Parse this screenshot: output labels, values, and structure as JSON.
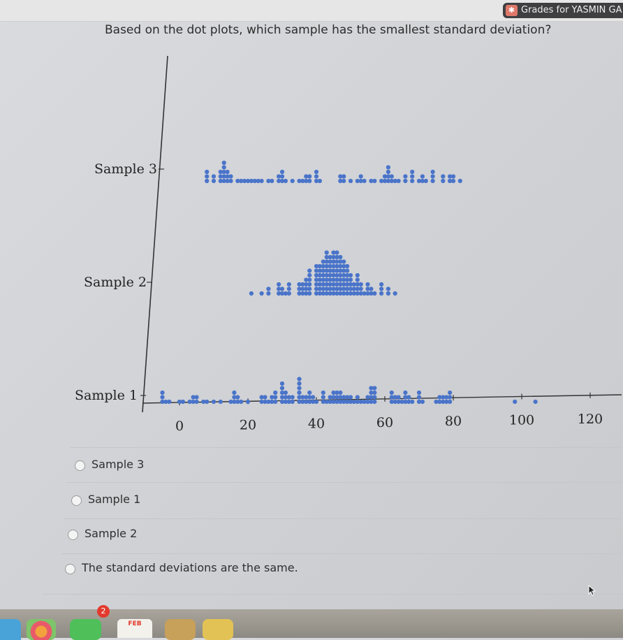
{
  "browser": {
    "tab_title": "Grades for YASMIN GA",
    "tab_icon": "grades-icon"
  },
  "question": {
    "text": "Based on the dot plots, which sample has the smallest standard deviation?"
  },
  "chart_data": {
    "type": "scatter",
    "subtype": "dot plot",
    "x_ticks": [
      0,
      20,
      40,
      60,
      80,
      100,
      120
    ],
    "xlim": [
      -10,
      125
    ],
    "categories": [
      "Sample 1",
      "Sample 2",
      "Sample 3"
    ],
    "dot_color": "#4a74c9",
    "series": [
      {
        "name": "Sample 3",
        "counts": [
          [
            8,
            3
          ],
          [
            10,
            2
          ],
          [
            12,
            3
          ],
          [
            13,
            5
          ],
          [
            14,
            3
          ],
          [
            15,
            2
          ],
          [
            17,
            1
          ],
          [
            18,
            1
          ],
          [
            19,
            1
          ],
          [
            20,
            1
          ],
          [
            21,
            1
          ],
          [
            22,
            1
          ],
          [
            23,
            1
          ],
          [
            24,
            1
          ],
          [
            26,
            1
          ],
          [
            27,
            1
          ],
          [
            29,
            2
          ],
          [
            30,
            3
          ],
          [
            31,
            1
          ],
          [
            33,
            1
          ],
          [
            35,
            1
          ],
          [
            36,
            1
          ],
          [
            37,
            2
          ],
          [
            38,
            2
          ],
          [
            40,
            3
          ],
          [
            41,
            1
          ],
          [
            47,
            2
          ],
          [
            48,
            2
          ],
          [
            50,
            1
          ],
          [
            52,
            1
          ],
          [
            53,
            2
          ],
          [
            54,
            1
          ],
          [
            56,
            1
          ],
          [
            57,
            1
          ],
          [
            59,
            1
          ],
          [
            60,
            2
          ],
          [
            61,
            4
          ],
          [
            62,
            2
          ],
          [
            63,
            1
          ],
          [
            64,
            1
          ],
          [
            66,
            2
          ],
          [
            68,
            3
          ],
          [
            70,
            1
          ],
          [
            71,
            2
          ],
          [
            72,
            1
          ],
          [
            74,
            3
          ],
          [
            77,
            2
          ],
          [
            79,
            2
          ],
          [
            80,
            2
          ],
          [
            82,
            1
          ]
        ]
      },
      {
        "name": "Sample 2",
        "counts": [
          [
            21,
            1
          ],
          [
            24,
            1
          ],
          [
            26,
            2
          ],
          [
            29,
            3
          ],
          [
            30,
            2
          ],
          [
            31,
            1
          ],
          [
            32,
            3
          ],
          [
            35,
            3
          ],
          [
            36,
            3
          ],
          [
            37,
            4
          ],
          [
            38,
            6
          ],
          [
            40,
            7
          ],
          [
            41,
            7
          ],
          [
            42,
            8
          ],
          [
            43,
            10
          ],
          [
            44,
            9
          ],
          [
            45,
            10
          ],
          [
            46,
            10
          ],
          [
            47,
            9
          ],
          [
            48,
            8
          ],
          [
            49,
            7
          ],
          [
            50,
            5
          ],
          [
            51,
            3
          ],
          [
            52,
            5
          ],
          [
            53,
            3
          ],
          [
            54,
            1
          ],
          [
            55,
            3
          ],
          [
            56,
            2
          ],
          [
            57,
            1
          ],
          [
            59,
            3
          ],
          [
            61,
            2
          ],
          [
            63,
            1
          ]
        ]
      },
      {
        "name": "Sample 1",
        "counts": [
          [
            -5,
            3
          ],
          [
            -4,
            1
          ],
          [
            -3,
            1
          ],
          [
            0,
            1
          ],
          [
            1,
            1
          ],
          [
            3,
            1
          ],
          [
            4,
            2
          ],
          [
            5,
            2
          ],
          [
            7,
            1
          ],
          [
            8,
            1
          ],
          [
            10,
            1
          ],
          [
            12,
            1
          ],
          [
            15,
            1
          ],
          [
            16,
            3
          ],
          [
            17,
            2
          ],
          [
            18,
            1
          ],
          [
            20,
            1
          ],
          [
            24,
            2
          ],
          [
            25,
            2
          ],
          [
            26,
            1
          ],
          [
            27,
            2
          ],
          [
            28,
            3
          ],
          [
            30,
            5
          ],
          [
            31,
            3
          ],
          [
            32,
            2
          ],
          [
            33,
            2
          ],
          [
            35,
            6
          ],
          [
            36,
            2
          ],
          [
            37,
            2
          ],
          [
            38,
            3
          ],
          [
            39,
            2
          ],
          [
            40,
            1
          ],
          [
            42,
            3
          ],
          [
            43,
            1
          ],
          [
            44,
            2
          ],
          [
            45,
            3
          ],
          [
            46,
            3
          ],
          [
            47,
            3
          ],
          [
            48,
            2
          ],
          [
            49,
            2
          ],
          [
            50,
            2
          ],
          [
            51,
            1
          ],
          [
            52,
            2
          ],
          [
            53,
            1
          ],
          [
            54,
            1
          ],
          [
            55,
            2
          ],
          [
            56,
            4
          ],
          [
            57,
            4
          ],
          [
            62,
            3
          ],
          [
            63,
            2
          ],
          [
            64,
            2
          ],
          [
            65,
            1
          ],
          [
            66,
            3
          ],
          [
            67,
            2
          ],
          [
            68,
            1
          ],
          [
            70,
            3
          ],
          [
            71,
            1
          ],
          [
            75,
            1
          ],
          [
            76,
            2
          ],
          [
            77,
            2
          ],
          [
            78,
            2
          ],
          [
            79,
            3
          ],
          [
            98,
            1
          ],
          [
            104,
            1
          ]
        ]
      }
    ]
  },
  "choices": [
    {
      "label": "Sample 3"
    },
    {
      "label": "Sample 1"
    },
    {
      "label": "Sample 2"
    },
    {
      "label": "The standard deviations are the same."
    }
  ],
  "dock": {
    "badge_count": "2",
    "calendar_month": "FEB"
  }
}
